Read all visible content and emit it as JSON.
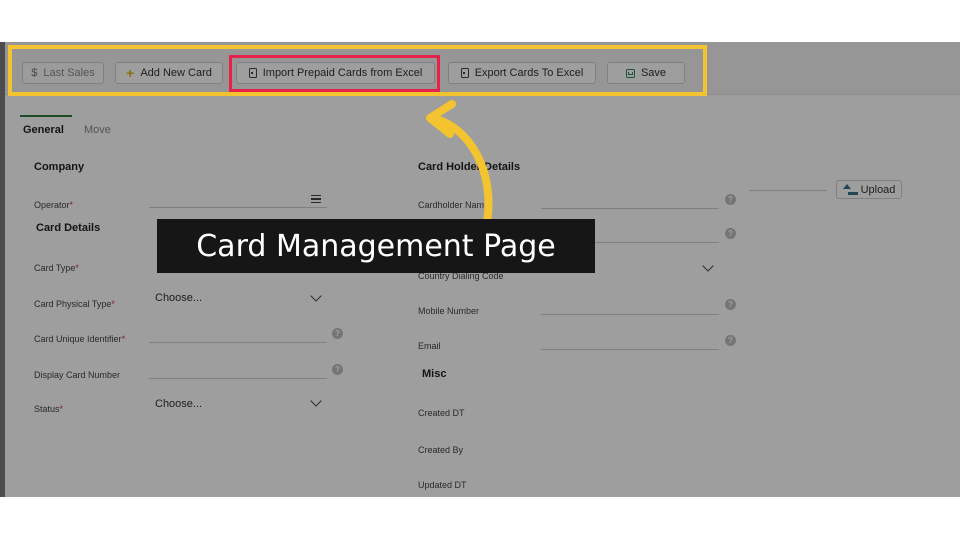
{
  "toolbar": {
    "last_sales": "Last Sales",
    "add_new_card": "Add New Card",
    "import_prepaid": "Import Prepaid Cards from Excel",
    "export_cards": "Export Cards To Excel",
    "save": "Save"
  },
  "tabs": [
    "General",
    "Move"
  ],
  "left": {
    "company_section": "Company",
    "operator_label": "Operator",
    "card_details_section": "Card Details",
    "card_type_label": "Card Type",
    "card_physical_type_label": "Card Physical Type",
    "card_physical_type_value": "Choose...",
    "card_unique_identifier_label": "Card Unique Identifier",
    "display_card_number_label": "Display Card Number",
    "status_label": "Status",
    "status_value": "Choose..."
  },
  "right": {
    "card_holder_section": "Card Holder Details",
    "cardholder_name_label": "Cardholder Name",
    "country_dialing_code_label": "Country Dialing Code",
    "mobile_number_label": "Mobile Number",
    "email_label": "Email",
    "misc_section": "Misc",
    "created_dt_label": "Created DT",
    "created_by_label": "Created By",
    "updated_dt_label": "Updated DT",
    "upload_button": "Upload"
  },
  "overlay": {
    "caption": "Card Management Page"
  },
  "colors": {
    "highlight_outer": "#f4c430",
    "highlight_button": "#e8214b",
    "arrow": "#f4c430",
    "caption_bg": "#161616"
  }
}
